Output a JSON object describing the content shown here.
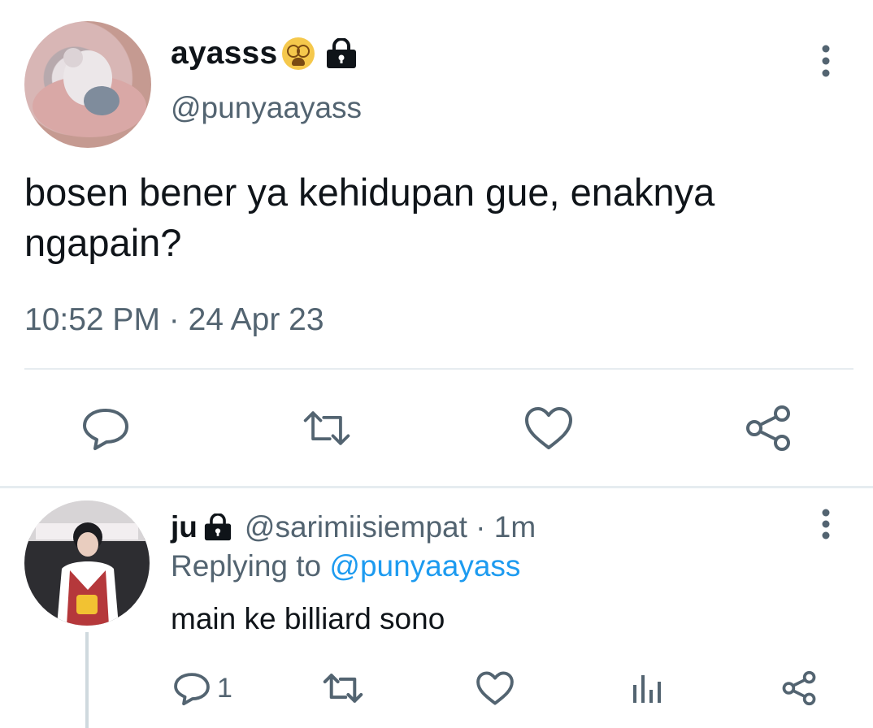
{
  "main_tweet": {
    "display_name": "ayasss",
    "emoji": "dizzy-face-emoji",
    "locked_icon": "lock-icon",
    "handle": "@punyaayass",
    "text": "bosen bener ya kehidupan gue, enaknya ngapain?",
    "timestamp": "10:52 PM · 24 Apr 23",
    "actions": [
      "reply-icon",
      "retweet-icon",
      "like-icon",
      "share-icon"
    ]
  },
  "reply_tweet": {
    "display_name": "ju",
    "locked_icon": "lock-icon",
    "handle_time": "@sarimiisiempat · 1m",
    "replying_prefix": "Replying to",
    "replying_to": "@punyaayass",
    "text": "main ke billiard sono",
    "reply_count": "1",
    "actions": [
      "reply-icon",
      "retweet-icon",
      "like-icon",
      "analytics-icon",
      "share-icon"
    ]
  },
  "colors": {
    "text": "#0f1419",
    "secondary": "#536471",
    "link": "#1d9bf0",
    "divider": "#e6ecf0"
  }
}
